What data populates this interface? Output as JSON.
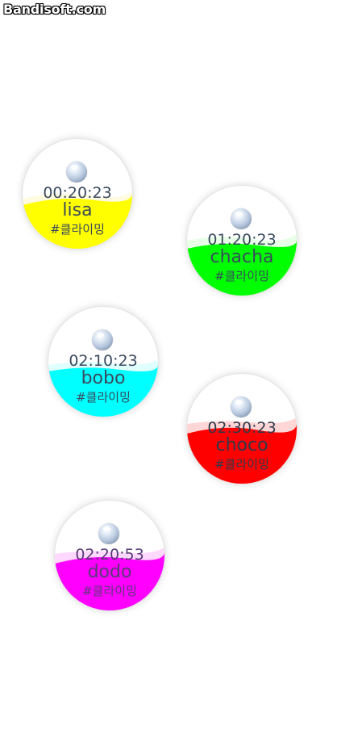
{
  "watermark": "Bandisoft.com",
  "bubbles": [
    {
      "id": "lisa",
      "time": "00:20:23",
      "name": "lisa",
      "tag": "#클라이밍",
      "color": "#ffff00",
      "tint": "#fffbe0"
    },
    {
      "id": "chacha",
      "time": "01:20:23",
      "name": "chacha",
      "tag": "#클라이밍",
      "color": "#00ff00",
      "tint": "#e6ffe6"
    },
    {
      "id": "bobo",
      "time": "02:10:23",
      "name": "bobo",
      "tag": "#클라이밍",
      "color": "#00ffff",
      "tint": "#e0ffff"
    },
    {
      "id": "choco",
      "time": "02:30:23",
      "name": "choco",
      "tag": "#클라이밍",
      "color": "#ff0000",
      "tint": "#ffd6d6"
    },
    {
      "id": "dodo",
      "time": "02:20:53",
      "name": "dodo",
      "tag": "#클라이밍",
      "color": "#ff00ff",
      "tint": "#ffd8ff"
    }
  ]
}
